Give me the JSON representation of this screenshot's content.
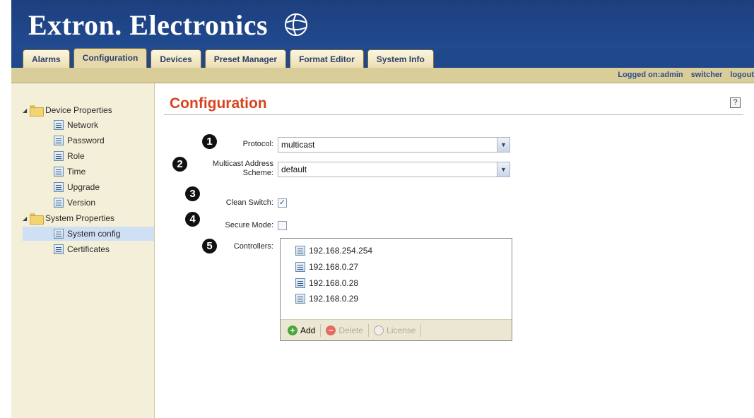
{
  "app": {
    "brand": "Extron. Electronics"
  },
  "tabs": [
    {
      "label": "Alarms"
    },
    {
      "label": "Configuration"
    },
    {
      "label": "Devices"
    },
    {
      "label": "Preset Manager"
    },
    {
      "label": "Format Editor"
    },
    {
      "label": "System Info"
    }
  ],
  "session": {
    "user_text": "Logged on:admin",
    "switcher_link": "switcher",
    "logout_link": "logout"
  },
  "sidebar": {
    "device_properties": "Device Properties",
    "device_items": [
      {
        "label": "Network"
      },
      {
        "label": "Password"
      },
      {
        "label": "Role"
      },
      {
        "label": "Time"
      },
      {
        "label": "Upgrade"
      },
      {
        "label": "Version"
      }
    ],
    "system_properties": "System Properties",
    "system_items": [
      {
        "label": "System config"
      },
      {
        "label": "Certificates"
      }
    ]
  },
  "main": {
    "title": "Configuration",
    "help": "?",
    "callouts": [
      "1",
      "2",
      "3",
      "4",
      "5"
    ],
    "protocol_label": "Protocol:",
    "protocol_value": "multicast",
    "multicast_label_line1": "Multicast Address",
    "multicast_label_line2": "Scheme:",
    "multicast_value": "default",
    "clean_switch_label": "Clean Switch:",
    "clean_switch_checked": true,
    "secure_mode_label": "Secure Mode:",
    "secure_mode_checked": false,
    "controllers_label": "Controllers:",
    "controllers": [
      {
        "address": "192.168.254.254"
      },
      {
        "address": "192.168.0.27"
      },
      {
        "address": "192.168.0.28"
      },
      {
        "address": "192.168.0.29"
      }
    ],
    "toolbar": {
      "add": "Add",
      "delete": "Delete",
      "license": "License"
    }
  },
  "colors": {
    "header_blue": "#214a8f",
    "tab_bar_tan": "#d9cd9a",
    "title_orange": "#d8431f",
    "sidebar_bg": "#f3efd8"
  }
}
